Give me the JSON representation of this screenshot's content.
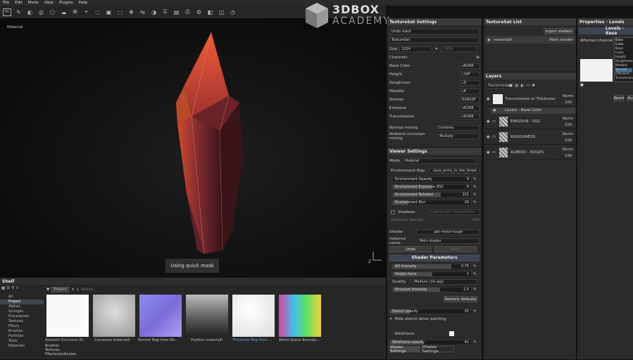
{
  "menubar": {
    "items": [
      "File",
      "Edit",
      "Mode",
      "View",
      "Plugins",
      "Help"
    ]
  },
  "toolbar": {
    "ps_label": "Ps"
  },
  "viewport": {
    "mode_label": "Material",
    "hint": "Using quick mask"
  },
  "logo": {
    "line1": "3DBOX",
    "line2": "ACADEMY"
  },
  "textureset_settings": {
    "title": "TextureSet Settings",
    "undo": "Undo stack",
    "ts_label": "TextureSet",
    "size_label": "Size",
    "size_value": "1024",
    "size_value2": "1024",
    "channels_label": "Channels",
    "channels": [
      {
        "name": "Base Color",
        "fmt": "sRGB8"
      },
      {
        "name": "Height",
        "fmt": "L16F"
      },
      {
        "name": "Roughness",
        "fmt": "L8"
      },
      {
        "name": "Metallic",
        "fmt": "L8"
      },
      {
        "name": "Normal",
        "fmt": "RGB16F"
      },
      {
        "name": "Emissive",
        "fmt": "sRGB8"
      },
      {
        "name": "Transmissive",
        "fmt": "sRGB8"
      }
    ],
    "normal_mixing_label": "Normal mixing",
    "normal_mixing_value": "Combine",
    "ao_mixing_label": "Ambient occlusion mixing",
    "ao_mixing_value": "Multiply"
  },
  "viewer_settings": {
    "title": "Viewer Settings",
    "mode_label": "Mode",
    "mode_value": "Material",
    "env_map_label": "Environment Map",
    "env_map_value": "cave_entry_in_the_forest",
    "sliders": [
      {
        "label": "Environment Opacity",
        "value": "0",
        "level": 0
      },
      {
        "label": "Environment Exposure (EV)",
        "value": "0",
        "level": 0.5
      },
      {
        "label": "Environment Rotation",
        "value": "221",
        "level": 0.61
      },
      {
        "label": "Environment Blur",
        "value": "20",
        "level": 0.2
      }
    ],
    "shadows_label": "Shadows",
    "shadows_value": "Lightweight computation",
    "shadows_opacity_label": "Shadows opacity",
    "shadows_opacity_value": "100",
    "shader_label": "Shader",
    "shader_value": "pbr-metal-rough",
    "instance_label": "Instance name",
    "instance_value": "Main shader",
    "undo_btn": "Undo",
    "redo_btn": "Redo",
    "shader_params_title": "Shader Parameters",
    "ao_label": "AO Intensity",
    "ao_value": "0.75",
    "ao_level": 0.75,
    "height_force_label": "Height force",
    "height_force_value": "1",
    "height_force_level": 0.5,
    "quality_label": "Quality",
    "quality_value": "Medium (16 spp)",
    "emissive_label": "Emissive Intensity",
    "emissive_value": "1.5",
    "emissive_level": 0.6,
    "restore_btn": "Restore defaults",
    "stencil_label": "Stencil opacity",
    "stencil_value": "25",
    "stencil_level": 0.25,
    "hide_stencil_label": "Hide stencil when painting",
    "wireframe_label": "Wireframe",
    "wireframe_opacity_label": "Wireframe opacity",
    "wireframe_opacity_value": "41",
    "wireframe_level": 0.41,
    "tab1": "Viewer Settings",
    "tab2": "Display Settings"
  },
  "textureset_list": {
    "title": "TextureSet List",
    "import_btn": "Import shaders",
    "item_name": "material0",
    "item_shader": "Main shader"
  },
  "layers": {
    "title": "Layers",
    "dropdown": "Transmissive",
    "items": [
      {
        "name": "Transmissive or Thickness",
        "blend": "Norm",
        "opacity": "100"
      },
      {
        "name": "Levels - Base Color",
        "blend": "",
        "opacity": ""
      },
      {
        "name": "EMISSIVE - SSS",
        "blend": "Norm",
        "opacity": "100"
      },
      {
        "name": "ROUGHNESS",
        "blend": "Norm",
        "opacity": "100"
      },
      {
        "name": "ALBEDO - EDGES",
        "blend": "Norm",
        "opacity": "100"
      }
    ]
  },
  "properties": {
    "title": "Properties - Levels",
    "section": "Levels - Base",
    "affected_label": "Affected channel",
    "affected_value": "Base Color",
    "options": [
      "Base Color",
      "Height",
      "Roughness",
      "Metallic",
      "Normal",
      "Emissive",
      "Transmissive"
    ],
    "reset_btn": "Reset",
    "auto_btn": "Au"
  },
  "shelf": {
    "title": "Shelf",
    "project_tag": "Project",
    "search_placeholder": "Search...",
    "categories": [
      "All",
      "Project",
      "Alphas",
      "Grunges",
      "Procedurals",
      "Textures",
      "Filters",
      "Brushes",
      "Particles",
      "Tools",
      "Materials"
    ],
    "subcategories": [
      "Brushes",
      "Textures",
      "Filterscoordinates"
    ],
    "items": [
      {
        "label": "Ambient Occlusion M..."
      },
      {
        "label": "Curvature material0"
      },
      {
        "label": "Normal Map from Me..."
      },
      {
        "label": "Position material0"
      },
      {
        "label": "Thickness Map from ..."
      },
      {
        "label": "World Space Normals..."
      }
    ]
  },
  "colors": {
    "accent": "#3d4650",
    "panel": "#2b2b2b",
    "crystal": "#8a2630"
  }
}
